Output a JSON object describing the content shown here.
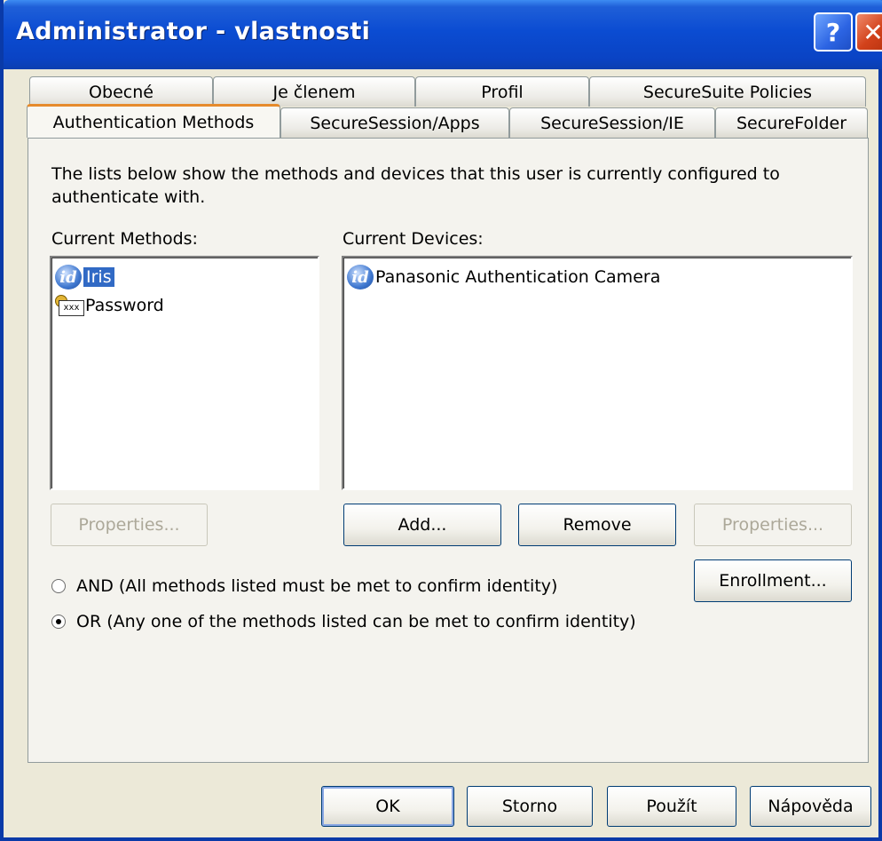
{
  "window": {
    "title": "Administrator - vlastnosti",
    "help_glyph": "?",
    "close_glyph": "✕"
  },
  "tabs": {
    "row1": [
      "Obecné",
      "Je členem",
      "Profil",
      "SecureSuite Policies"
    ],
    "row2": [
      "Authentication Methods",
      "SecureSession/Apps",
      "SecureSession/IE",
      "SecureFolder"
    ],
    "active": "Authentication Methods"
  },
  "panel": {
    "description": "The lists below show the methods and devices that this user is currently configured to authenticate with.",
    "methods_label": "Current Methods:",
    "devices_label": "Current Devices:",
    "methods": [
      {
        "label": "Iris",
        "icon": "iris-id-icon",
        "selected": true
      },
      {
        "label": "Password",
        "icon": "password-key-icon",
        "selected": false
      }
    ],
    "devices": [
      {
        "label": "Panasonic  Authentication Camera",
        "icon": "camera-id-icon",
        "selected": false
      }
    ],
    "buttons": {
      "methods_properties": "Properties...",
      "add": "Add...",
      "remove": "Remove",
      "devices_properties": "Properties...",
      "enrollment": "Enrollment..."
    },
    "radios": [
      {
        "label": "AND (All methods listed must be met to confirm identity)",
        "checked": false
      },
      {
        "label": "OR (Any one of the methods listed can be met to confirm identity)",
        "checked": true
      }
    ]
  },
  "footer": {
    "ok": "OK",
    "cancel": "Storno",
    "apply": "Použít",
    "help": "Nápověda"
  },
  "icon_glyphs": {
    "id": "id",
    "password_box": "xxx"
  }
}
